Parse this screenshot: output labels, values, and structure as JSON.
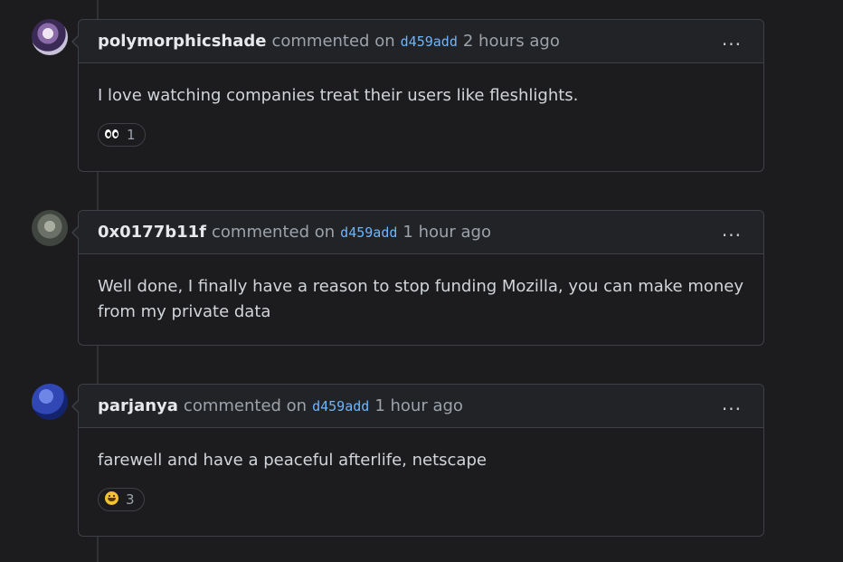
{
  "comments": [
    {
      "author": "polymorphicshade",
      "action": "commented on",
      "commit": "d459add",
      "time": "2 hours ago",
      "more": "...",
      "body": "I love watching companies treat their users like fleshlights.",
      "reaction": {
        "icon": "eyes-icon",
        "count": "1"
      }
    },
    {
      "author": "0x0177b11f",
      "action": "commented on",
      "commit": "d459add",
      "time": "1 hour ago",
      "more": "...",
      "body": "Well done, I finally have a reason to stop funding Mozilla, you can make money from my private data"
    },
    {
      "author": "parjanya",
      "action": "commented on",
      "commit": "d459add",
      "time": "1 hour ago",
      "more": "...",
      "body": "farewell and have a peaceful afterlife, netscape",
      "reaction": {
        "icon": "smile-icon",
        "count": "3"
      }
    }
  ]
}
